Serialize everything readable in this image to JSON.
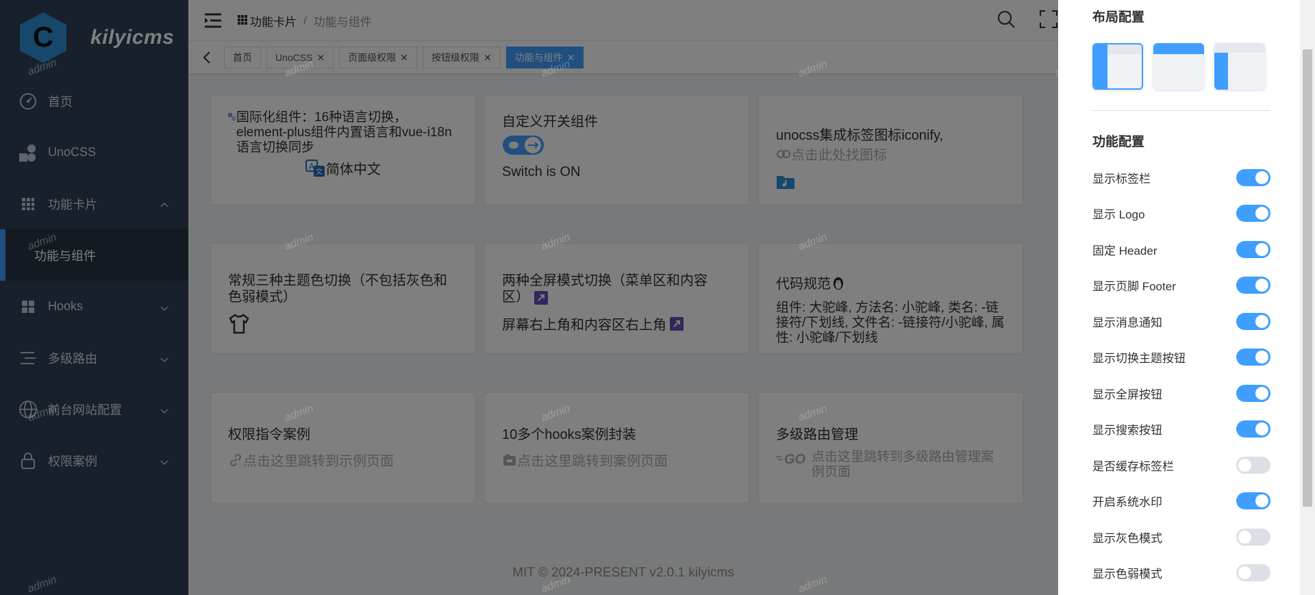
{
  "app": {
    "name": "kilyicms",
    "logo_letter": "C"
  },
  "sidebar": {
    "items": [
      {
        "label": "首页",
        "icon": "dashboard-icon"
      },
      {
        "label": "UnoCSS",
        "icon": "unocss-icon"
      },
      {
        "label": "功能卡片",
        "icon": "grid-icon",
        "expanded": true,
        "children": [
          {
            "label": "功能与组件"
          }
        ]
      },
      {
        "label": "Hooks",
        "icon": "apps-icon"
      },
      {
        "label": "多级路由",
        "icon": "menu-lines-icon"
      },
      {
        "label": "前台网站配置",
        "icon": "globe-icon"
      },
      {
        "label": "权限案例",
        "icon": "lock-icon"
      }
    ]
  },
  "navbar": {
    "breadcrumb": {
      "parent": "功能卡片",
      "current": "功能与组件"
    }
  },
  "tags": [
    {
      "label": "首页",
      "closable": false,
      "active": false
    },
    {
      "label": "UnoCSS",
      "closable": true,
      "active": false
    },
    {
      "label": "页面级权限",
      "closable": true,
      "active": false
    },
    {
      "label": "按钮级权限",
      "closable": true,
      "active": false
    },
    {
      "label": "功能与组件",
      "closable": true,
      "active": true
    }
  ],
  "cards": [
    {
      "title": "国际化组件：16种语言切换，element-plus组件内置语言和vue-i18n语言切换同步",
      "line2": "简体中文"
    },
    {
      "title": "自定义开关组件",
      "line2": "Switch is ON"
    },
    {
      "title": "unocss集成标签图标iconify,",
      "line2": "点击此处找图标"
    },
    {
      "title": "常规三种主题色切换（不包括灰色和色弱模式）"
    },
    {
      "title": "两种全屏模式切换（菜单区和内容区）",
      "line2": "屏幕右上角和内容区右上角"
    },
    {
      "title": "代码规范",
      "line2": "组件: 大驼峰, 方法名: 小驼峰, 类名: -链接符/下划线, 文件名: -链接符/小驼峰, 属性: 小驼峰/下划线"
    },
    {
      "title": "权限指令案例",
      "line2": "点击这里跳转到示例页面"
    },
    {
      "title": "10多个hooks案例封装",
      "line2": "点击这里跳转到案例页面"
    },
    {
      "title": "多级路由管理",
      "line2": "点击这里跳转到多级路由管理案例页面"
    }
  ],
  "footer": "MIT © 2024-PRESENT v2.0.1 kilyicms",
  "watermark": "admin",
  "panel": {
    "layout_title": "布局配置",
    "feature_title": "功能配置",
    "settings": [
      {
        "label": "显示标签栏",
        "on": true
      },
      {
        "label": "显示 Logo",
        "on": true
      },
      {
        "label": "固定 Header",
        "on": true
      },
      {
        "label": "显示页脚 Footer",
        "on": true
      },
      {
        "label": "显示消息通知",
        "on": true
      },
      {
        "label": "显示切换主题按钮",
        "on": true
      },
      {
        "label": "显示全屏按钮",
        "on": true
      },
      {
        "label": "显示搜索按钮",
        "on": true
      },
      {
        "label": "是否缓存标签栏",
        "on": false
      },
      {
        "label": "开启系统水印",
        "on": true
      },
      {
        "label": "显示灰色模式",
        "on": false
      },
      {
        "label": "显示色弱模式",
        "on": false
      }
    ]
  },
  "colors": {
    "primary": "#409eff",
    "sidebar_bg": "#304156"
  }
}
